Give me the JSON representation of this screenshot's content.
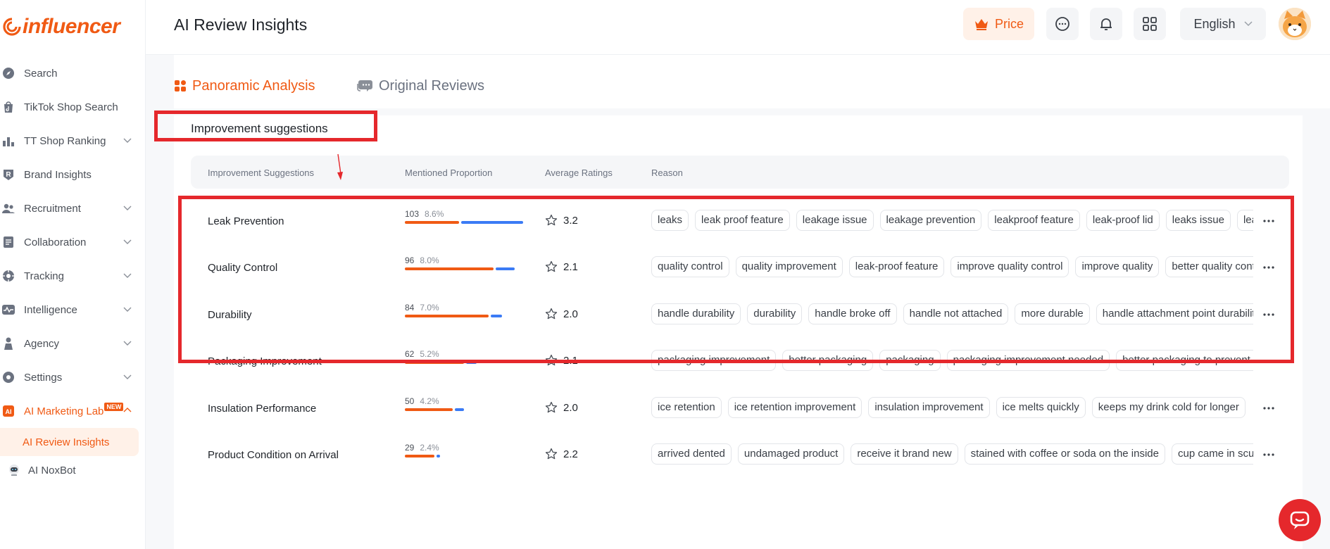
{
  "brand": {
    "logo_text": "influencer"
  },
  "sidebar": {
    "items": [
      {
        "label": "Search",
        "icon": "compass-icon",
        "chevron": false
      },
      {
        "label": "TikTok Shop Search",
        "icon": "tiktok-bag-icon",
        "chevron": false
      },
      {
        "label": "TT Shop Ranking",
        "icon": "bar-chart-icon",
        "chevron": true
      },
      {
        "label": "Brand Insights",
        "icon": "brand-r-icon",
        "chevron": false
      },
      {
        "label": "Recruitment",
        "icon": "users-icon",
        "chevron": true
      },
      {
        "label": "Collaboration",
        "icon": "document-icon",
        "chevron": true
      },
      {
        "label": "Tracking",
        "icon": "target-icon",
        "chevron": true
      },
      {
        "label": "Intelligence",
        "icon": "pulse-icon",
        "chevron": true
      },
      {
        "label": "Agency",
        "icon": "person-icon",
        "chevron": true
      },
      {
        "label": "Settings",
        "icon": "gear-icon",
        "chevron": true
      }
    ],
    "ai_lab": {
      "label": "AI Marketing Lab",
      "badge": "NEW",
      "icon": "ai-chip-icon"
    },
    "ai_review": {
      "label": "AI Review Insights"
    },
    "ai_bot": {
      "label": "AI NoxBot",
      "icon": "robot-icon"
    }
  },
  "header": {
    "title": "AI Review Insights",
    "price_label": "Price",
    "language": "English",
    "icons": [
      "chat-icon",
      "bell-icon",
      "apps-grid-icon"
    ]
  },
  "tabs": [
    {
      "label": "Panoramic Analysis",
      "active": true,
      "icon": "grid-four-icon"
    },
    {
      "label": "Original Reviews",
      "active": false,
      "icon": "comments-icon"
    }
  ],
  "section": {
    "title": "Improvement suggestions"
  },
  "table": {
    "columns": {
      "name": "Improvement Suggestions",
      "proportion": "Mentioned Proportion",
      "rating": "Average Ratings",
      "reason": "Reason"
    },
    "rows": [
      {
        "name": "Leak Prevention",
        "count": "103",
        "pct": "8.6%",
        "orange_share": 0.47,
        "blue_share": 0.53,
        "total_share": 1.0,
        "rating": "3.2",
        "tags": [
          "leaks",
          "leak proof feature",
          "leakage issue",
          "leakage prevention",
          "leakproof feature",
          "leak-proof lid",
          "leaks issue",
          "leak proof"
        ]
      },
      {
        "name": "Quality Control",
        "count": "96",
        "pct": "8.0%",
        "orange_share": 0.82,
        "blue_share": 0.18,
        "total_share": 0.93,
        "rating": "2.1",
        "tags": [
          "quality control",
          "quality improvement",
          "leak-proof feature",
          "improve quality control",
          "improve quality",
          "better quality control"
        ]
      },
      {
        "name": "Durability",
        "count": "84",
        "pct": "7.0%",
        "orange_share": 0.88,
        "blue_share": 0.12,
        "total_share": 0.82,
        "rating": "2.0",
        "tags": [
          "handle durability",
          "durability",
          "handle broke off",
          "handle not attached",
          "more durable",
          "handle attachment point durability"
        ]
      },
      {
        "name": "Packaging Improvement",
        "count": "62",
        "pct": "5.2%",
        "orange_share": 0.84,
        "blue_share": 0.16,
        "total_share": 0.61,
        "rating": "2.1",
        "tags": [
          "packaging improvement",
          "better packaging",
          "packaging",
          "packaging improvement needed",
          "better packaging to prevent damage"
        ]
      },
      {
        "name": "Insulation Performance",
        "count": "50",
        "pct": "4.2%",
        "orange_share": 0.83,
        "blue_share": 0.17,
        "total_share": 0.5,
        "rating": "2.0",
        "tags": [
          "ice retention",
          "ice retention improvement",
          "insulation improvement",
          "ice melts quickly",
          "keeps my drink cold for longer"
        ]
      },
      {
        "name": "Product Condition on Arrival",
        "count": "29",
        "pct": "2.4%",
        "orange_share": 0.87,
        "blue_share": 0.13,
        "total_share": 0.3,
        "rating": "2.2",
        "tags": [
          "arrived dented",
          "undamaged product",
          "receive it brand new",
          "stained with coffee or soda on the inside",
          "cup came in scuffed"
        ]
      }
    ]
  },
  "colors": {
    "accent": "#f05a14",
    "blue": "#3b7bf5",
    "annotation_red": "#e5282c"
  }
}
